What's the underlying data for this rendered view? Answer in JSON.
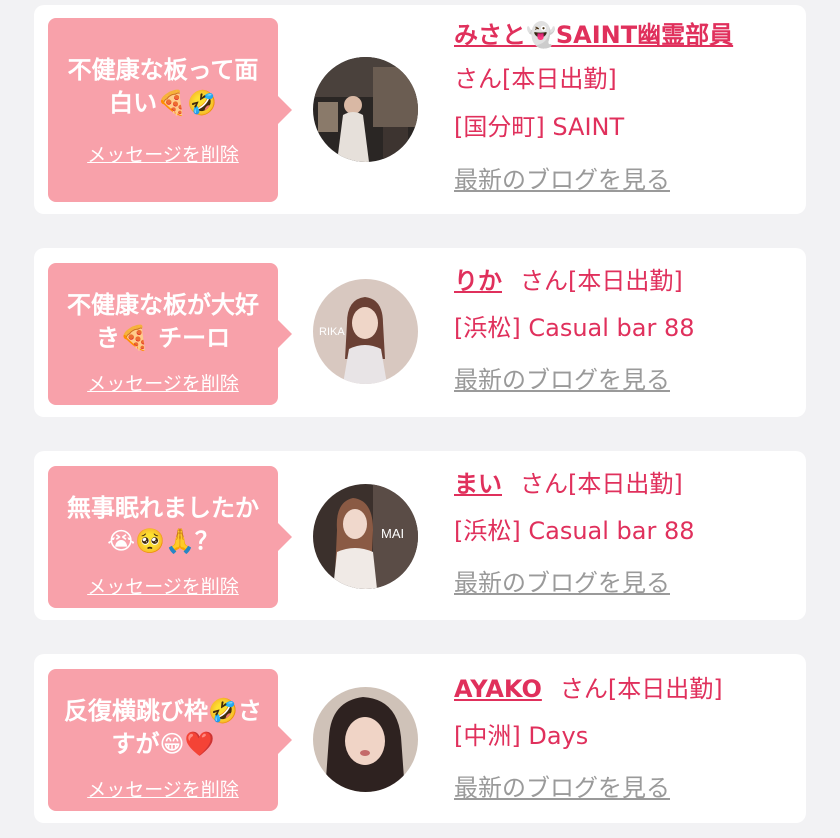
{
  "colors": {
    "bubble": "#f8a1aa",
    "accent": "#e0305c",
    "link_gray": "#9a9a9a",
    "background": "#f2f2f4",
    "card": "#ffffff"
  },
  "delete_label": "メッセージを削除",
  "blog_label": "最新のブログを見る",
  "cards": [
    {
      "message": "不健康な板って面白い🍕🤣",
      "name": "みさと👻SAINT幽霊部員",
      "san": "さん[本日出勤]",
      "shop": "[国分町] SAINT",
      "avatar_icon": "profile-photo"
    },
    {
      "message": "不健康な板が大好き🍕 チーロ",
      "name": "りか",
      "san": "さん[本日出勤]",
      "shop": "[浜松] Casual bar 88",
      "avatar_icon": "profile-photo",
      "avatar_text": "RIKA"
    },
    {
      "message": "無事眠れましたか😭🥺🙏？",
      "name": "まい",
      "san": "さん[本日出勤]",
      "shop": "[浜松] Casual bar 88",
      "avatar_icon": "profile-photo",
      "avatar_text": "MAI"
    },
    {
      "message": "反復横跳び枠🤣さすが😁❤️",
      "name": "AYAKO",
      "san": "さん[本日出勤]",
      "shop": "[中洲] Days",
      "avatar_icon": "profile-photo"
    }
  ]
}
